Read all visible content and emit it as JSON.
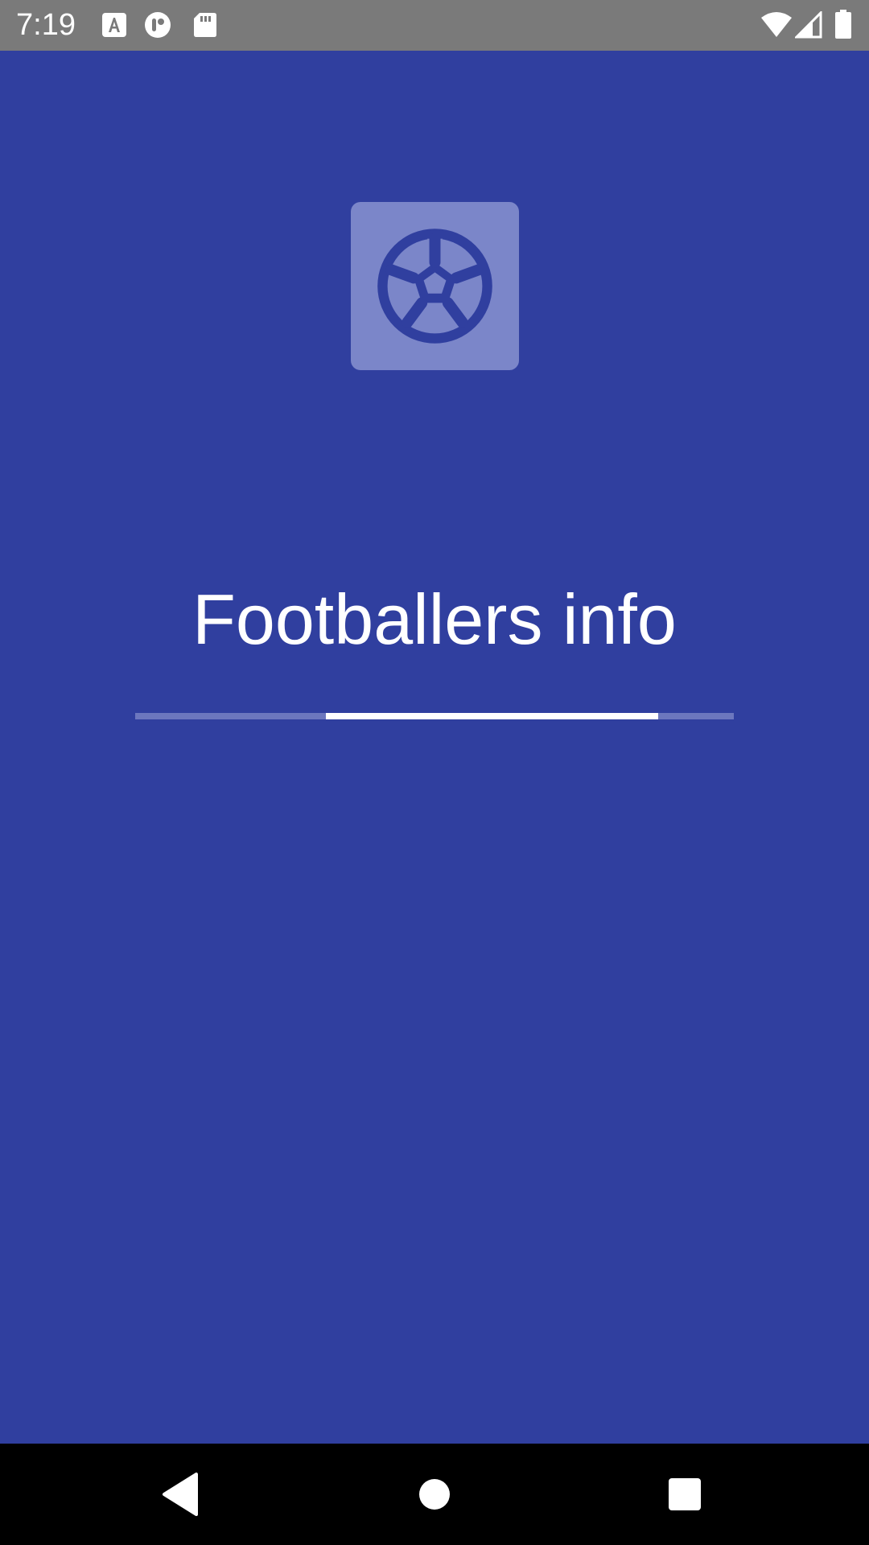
{
  "status_bar": {
    "time": "7:19",
    "left_icons": [
      "font-app-icon",
      "notification-app-icon",
      "sd-card-icon"
    ],
    "right_icons": [
      "wifi-icon",
      "cellular-signal-icon",
      "battery-icon"
    ]
  },
  "splash": {
    "logo_icon": "soccer-ball-icon",
    "title": "Footballers info",
    "progress": "indeterminate"
  },
  "nav_bar": {
    "buttons": [
      "back-icon",
      "home-icon",
      "recents-icon"
    ]
  },
  "colors": {
    "background": "#303F9F",
    "logo_tile": "#7B86C9",
    "status_bar": "#7a7a7a",
    "nav_bar": "#000000",
    "progress_track": "#6C77BE",
    "progress_indicator": "#ffffff"
  }
}
